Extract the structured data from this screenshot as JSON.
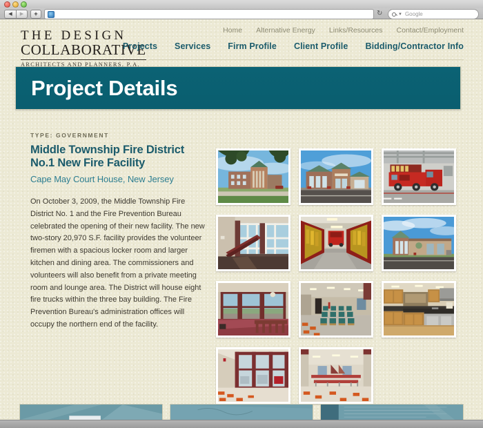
{
  "browser": {
    "window_controls": [
      "close",
      "minimize",
      "zoom"
    ],
    "back_label": "◀",
    "forward_label": "▶",
    "new_tab_label": "+",
    "url_value": "",
    "url_placeholder": "",
    "reload_label": "↻",
    "search_placeholder": "Google",
    "search_value": ""
  },
  "site": {
    "logo": {
      "line1": "THE DESIGN",
      "line2": "COLLABORATIVE",
      "line3": "ARCHITECTS AND PLANNERS, P.A."
    },
    "top_nav": [
      {
        "label": "Home"
      },
      {
        "label": "Alternative Energy"
      },
      {
        "label": "Links/Resources"
      },
      {
        "label": "Contact/Employment"
      }
    ],
    "main_nav": [
      {
        "label": "Projects"
      },
      {
        "label": "Services"
      },
      {
        "label": "Firm Profile"
      },
      {
        "label": "Client Profile"
      },
      {
        "label": "Bidding/Contractor Info"
      }
    ],
    "banner": {
      "title": "Project Details"
    },
    "project": {
      "type_label": "TYPE: GOVERNMENT",
      "title": "Middle Township Fire District No.1 New Fire Facility",
      "location": "Cape May Court House, New Jersey",
      "description": "On October 3, 2009, the Middle Township Fire District No. 1 and the Fire Prevention Bureau celebrated the opening of their new facility. The new two-story 20,970 S.F. facility provides the volunteer firemen with a spacious locker room and larger kitchen and dining area. The commissioners and volunteers will also benefit from a private meeting room and lounge area. The District will house eight fire trucks within the three bay building. The Fire Prevention Bureau's administration offices will occupy the northern end of the facility."
    },
    "gallery": [
      {
        "name": "exterior-front-with-tree"
      },
      {
        "name": "exterior-main-entrance"
      },
      {
        "name": "apparatus-bay-fire-trucks"
      },
      {
        "name": "lobby-stairway"
      },
      {
        "name": "turnout-gear-corridor"
      },
      {
        "name": "exterior-side-elevation"
      },
      {
        "name": "lounge-balcony-windows"
      },
      {
        "name": "meeting-room-seating"
      },
      {
        "name": "commercial-kitchen"
      },
      {
        "name": "interior-window-corridor"
      },
      {
        "name": "dining-hall-tables"
      }
    ],
    "bottom_cards": [
      {
        "name": "project-card-1"
      },
      {
        "name": "project-card-2"
      },
      {
        "name": "project-card-3"
      }
    ],
    "colors": {
      "page_background": "#ece9d4",
      "banner_teal": "#0b6274",
      "nav_teal": "#1b5b6b",
      "top_nav_muted": "#8d8b74",
      "location_teal": "#2d7e91",
      "body_text": "#3c382f"
    }
  }
}
